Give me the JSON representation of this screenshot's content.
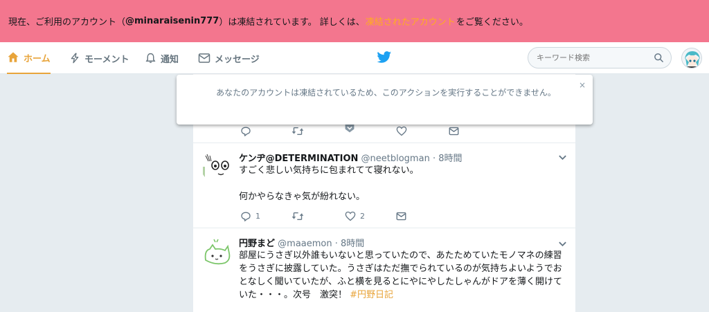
{
  "banner": {
    "prefix": "現在、ご利用のアカウント（",
    "account": "@minaraisenin777",
    "middle": "）は凍結されています。 詳しくは、",
    "link": "凍結されたアカウント",
    "suffix": "をご覧ください。"
  },
  "nav": {
    "home": "ホーム",
    "moments": "モーメント",
    "notifications": "通知",
    "messages": "メッセージ"
  },
  "search": {
    "placeholder": "キーワード検索"
  },
  "toast": {
    "message": "あなたのアカウントは凍結されているため、このアクションを実行することができません。",
    "close": "×"
  },
  "tweets": [
    {
      "name": "ケンヂ@DETERMINATION",
      "handle": "@neetblogman",
      "time": "· 8時間",
      "body": "すごく悲しい気持ちに包まれてて寝れない。\n\n何かやらなきゃ気が紛れない。",
      "reply_count": "1",
      "retweet_count": "",
      "like_count": "2"
    },
    {
      "name": "円野まど",
      "handle": "@maaemon",
      "time": "· 8時間",
      "body": "部屋にうさぎ以外誰もいないと思っていたので、あたためていたモノマネの練習をうさぎに披露していた。うさぎはただ撫でられているのが気持ちよいようでおとなしく聞いていたが、ふと横を見るとにやにやしたしゃんがドアを薄く開けていた・・・。次号　激突！ ",
      "hashtag": "#円野日記"
    }
  ],
  "colors": {
    "banner_bg": "#f3768e",
    "accent": "#e8a43a",
    "twitter_blue": "#1da1f2",
    "page_bg": "#e6ecf0"
  },
  "icons": {
    "home": "home-icon",
    "moments": "lightning-icon",
    "notifications": "bell-icon",
    "messages": "envelope-icon",
    "logo": "twitter-bird-icon",
    "search": "search-icon",
    "reply": "reply-icon",
    "retweet": "retweet-icon",
    "like": "heart-icon",
    "dm": "envelope-icon",
    "caret": "chevron-down-icon"
  }
}
